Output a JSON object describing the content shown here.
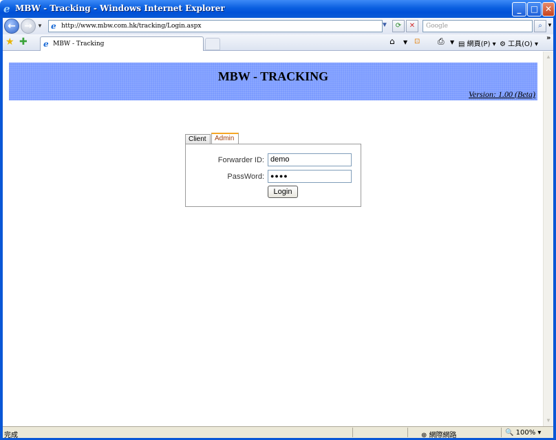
{
  "window": {
    "title": "MBW - Tracking - Windows Internet Explorer",
    "min_glyph": "_",
    "max_glyph": "□",
    "close_glyph": "✕"
  },
  "address_bar": {
    "url": "http://www.mbw.com.hk/tracking/Login.aspx",
    "search_placeholder": "Google"
  },
  "browser_tab": {
    "label": "MBW - Tracking"
  },
  "command_bar": {
    "page_label": "網頁(P)",
    "tools_label": "工具(O)"
  },
  "header": {
    "title": "MBW - TRACKING",
    "version": "Version: 1.00 (Beta)"
  },
  "login": {
    "tabs": [
      "Client",
      "Admin"
    ],
    "active_tab": "Admin",
    "forwarder_label": "Forwarder ID:",
    "forwarder_value": "demo",
    "password_label": "PassWord:",
    "password_masked": "●●●●",
    "button_label": "Login"
  },
  "status_bar": {
    "status": "完成",
    "zone": "網際網路",
    "zoom": "100%"
  },
  "colors": {
    "header_bg": "#7b9bff",
    "active_tab_accent": "#f5a623",
    "titlebar": "#0a5fe0"
  }
}
